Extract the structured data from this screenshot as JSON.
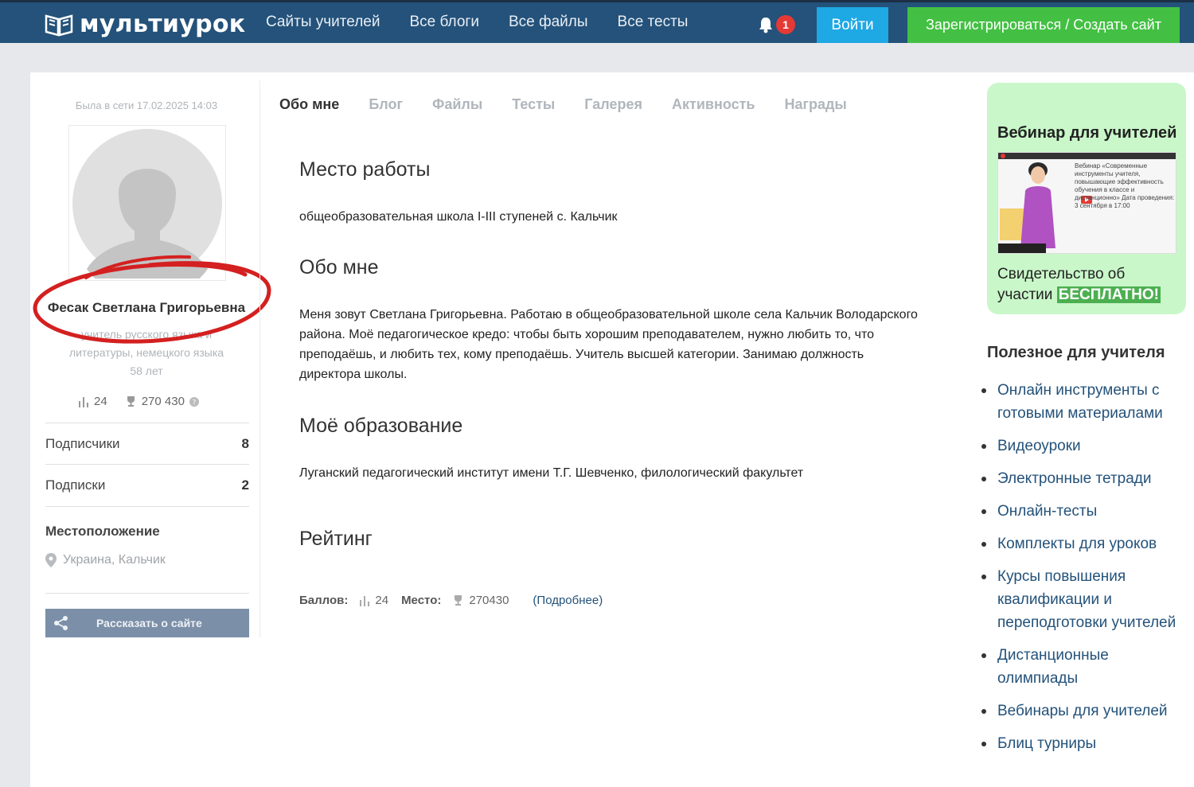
{
  "header": {
    "logo_text": "мультиурок",
    "nav": [
      "Сайты учителей",
      "Все блоги",
      "Все файлы",
      "Все тесты"
    ],
    "notifications_count": "1",
    "login_label": "Войти",
    "register_label": "Зарегистрироваться / Создать сайт"
  },
  "profile": {
    "last_online": "Была в сети 17.02.2025 14:03",
    "name": "Фесак Светлана Григорьевна",
    "role": "учитель русского языка и литературы, немецкого языка",
    "age": "58 лет",
    "stats": {
      "points": "24",
      "place": "270 430"
    },
    "subscribers_label": "Подписчики",
    "subscribers_count": "8",
    "subscriptions_label": "Подписки",
    "subscriptions_count": "2",
    "location_title": "Местоположение",
    "location": "Украина, Кальчик",
    "share_label": "Рассказать о сайте"
  },
  "tabs": [
    "Обо мне",
    "Блог",
    "Файлы",
    "Тесты",
    "Галерея",
    "Активность",
    "Награды"
  ],
  "main": {
    "work_title": "Место работы",
    "work_text": "общеобразовательная школа I-III ступеней с. Кальчик",
    "about_title": "Обо мне",
    "about_text": "Меня зовут Светлана Григорьевна. Работаю в общеобразовательной школе села Кальчик Володарского района. Моё педагогическое кредо: чтобы быть хорошим преподавателем, нужно любить то, что преподаёшь, и любить тех, кому преподаёшь. Учитель высшей категории. Занимаю должность директора школы.",
    "education_title": "Моё образование",
    "education_text": "Луганский педагогический институт имени Т.Г. Шевченко, филологический факультет",
    "rating_title": "Рейтинг",
    "rating": {
      "points_label": "Баллов:",
      "points": "24",
      "place_label": "Место:",
      "place": "270430",
      "more_label": "(Подробнее)"
    }
  },
  "sidebar_right": {
    "webinar_title": "Вебинар для учителей",
    "thumb_text": "Вебинар «Современные инструменты учителя, повышающие эффективность обучения в классе и дистанционно» Дата проведения: 3 сентября в 17:00",
    "certificate_text": "Свидетельство об участии",
    "free_label": "БЕСПЛАТНО!",
    "useful_title": "Полезное для учителя",
    "useful_links": [
      "Онлайн инструменты с готовыми материалами",
      "Видеоуроки",
      "Электронные тетради",
      "Онлайн-тесты",
      "Комплекты для уроков",
      "Курсы повышения квалификации и переподготовки учителей",
      "Дистанционные олимпиады",
      "Вебинары для учителей",
      "Блиц турниры"
    ]
  },
  "colors": {
    "header_bg": "#24527a",
    "login_btn": "#1ea8e4",
    "register_btn": "#43c043",
    "webinar_bg": "#c9f7c9",
    "annotation_red": "#d42020"
  }
}
